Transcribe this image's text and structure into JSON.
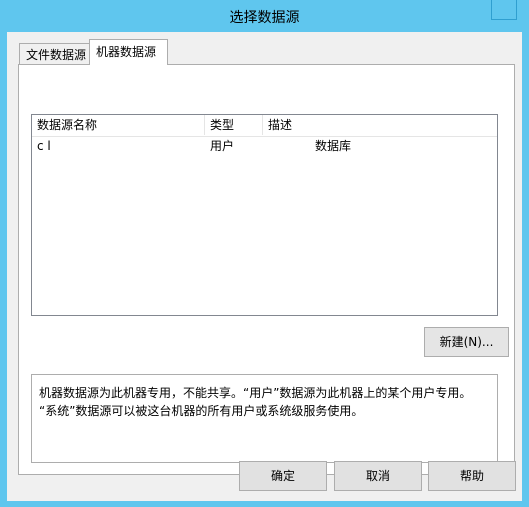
{
  "window": {
    "title": "选择数据源"
  },
  "tabs": [
    {
      "label": "文件数据源",
      "active": false
    },
    {
      "label": "机器数据源",
      "active": true
    }
  ],
  "list": {
    "columns": [
      "数据源名称",
      "类型",
      "描述"
    ],
    "rows": [
      {
        "name": "c l",
        "type": "用户",
        "description": "数据库"
      }
    ]
  },
  "buttons": {
    "new": "新建(N)...",
    "ok": "确定",
    "cancel": "取消",
    "help": "帮助"
  },
  "description_text": {
    "line1": "机器数据源为此机器专用，不能共享。“用户”数据源为此机器上的某个用户专用。",
    "line2": "“系统”数据源可以被这台机器的所有用户或系统级服务使用。"
  },
  "colors": {
    "titlebar": "#5fc6ee",
    "dialog_bg": "#f0f0f0",
    "button_bg": "#e1e1e1"
  }
}
